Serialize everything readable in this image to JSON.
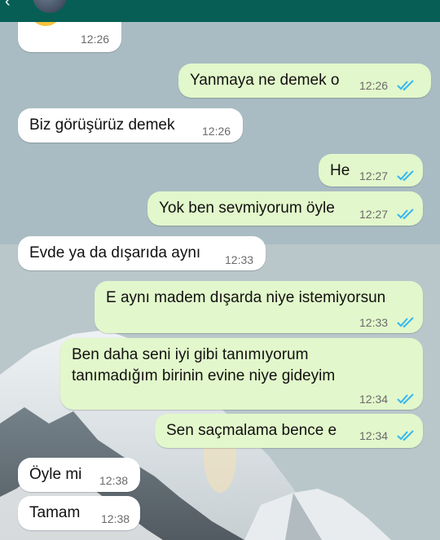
{
  "messages": [
    {
      "id": "m0",
      "dir": "in",
      "text": "",
      "time": "12:26",
      "emoji": "smiling-face-icon"
    },
    {
      "id": "m1",
      "dir": "out",
      "text": "Yanmaya ne demek o",
      "time": "12:26",
      "read": true
    },
    {
      "id": "m2",
      "dir": "in",
      "text": "Biz görüşürüz demek",
      "time": "12:26"
    },
    {
      "id": "m3",
      "dir": "out",
      "text": "He",
      "time": "12:27",
      "read": true
    },
    {
      "id": "m4",
      "dir": "out",
      "text": "Yok ben sevmiyorum öyle",
      "time": "12:27",
      "read": true
    },
    {
      "id": "m5",
      "dir": "in",
      "text": "Evde ya da dışarıda aynı",
      "time": "12:33"
    },
    {
      "id": "m6",
      "dir": "out",
      "text": "E aynı madem dışarda niye istemiyorsun",
      "time": "12:33",
      "read": true
    },
    {
      "id": "m7",
      "dir": "out",
      "text": "Ben daha seni iyi gibi tanımıyorum\ntanımadığım birinin evine niye gideyim",
      "time": "12:34",
      "read": true
    },
    {
      "id": "m8",
      "dir": "out",
      "text": "Sen saçmalama bence e",
      "time": "12:34",
      "read": true
    },
    {
      "id": "m9",
      "dir": "in",
      "text": "Öyle mi",
      "time": "12:38"
    },
    {
      "id": "m10",
      "dir": "in",
      "text": "Tamam",
      "time": "12:38"
    }
  ],
  "colors": {
    "header": "#075e54",
    "outgoing": "#e2f7cb",
    "incoming": "#ffffff",
    "read_ticks": "#34b7f1"
  },
  "icons": {
    "read": "double-check-icon",
    "back": "back-arrow-icon"
  }
}
